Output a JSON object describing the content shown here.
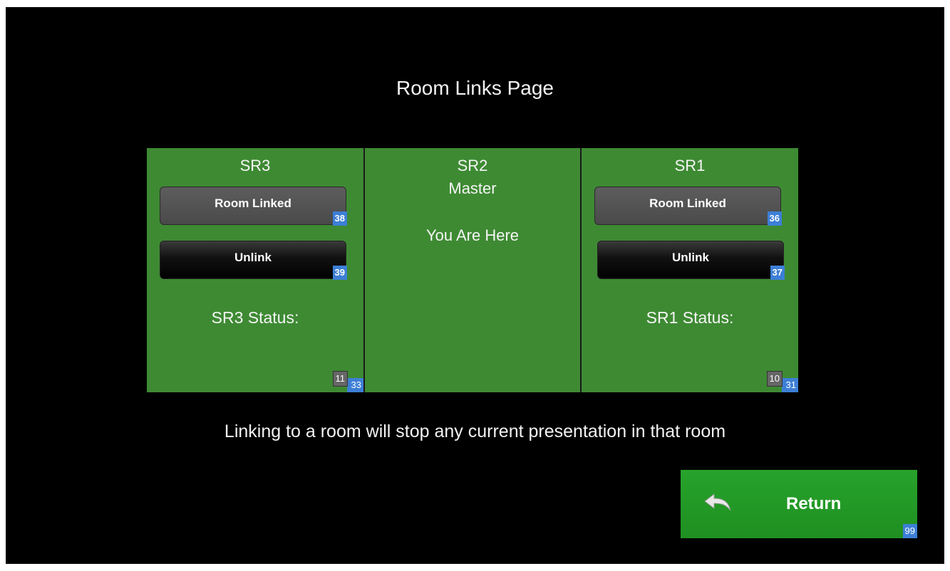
{
  "page": {
    "title": "Room Links Page"
  },
  "rooms": [
    {
      "name": "SR3",
      "linked_label": "Room Linked",
      "linked_code": "38",
      "unlink_label": "Unlink",
      "unlink_code": "39",
      "status_label": "SR3 Status:",
      "status_code": "11",
      "panel_code": "33"
    },
    {
      "name": "SR2",
      "role": "Master",
      "note": "You Are Here"
    },
    {
      "name": "SR1",
      "linked_label": "Room Linked",
      "linked_code": "36",
      "unlink_label": "Unlink",
      "unlink_code": "37",
      "status_label": "SR1 Status:",
      "status_code": "10",
      "panel_code": "31"
    }
  ],
  "warning": "Linking to a room will stop any current presentation in that room",
  "return_button": {
    "label": "Return",
    "code": "99",
    "icon": "back-arrow-icon"
  },
  "colors": {
    "panel_green": "#3e8a33",
    "return_green": "#27a32b",
    "code_blue": "#3d7fd6",
    "background": "#000000"
  }
}
